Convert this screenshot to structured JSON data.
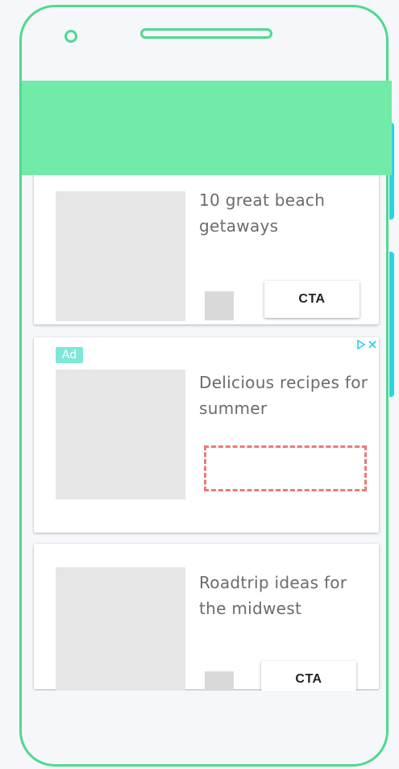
{
  "feed": {
    "cards": [
      {
        "title": "10 great beach getaways",
        "cta": "CTA"
      },
      {
        "ad_badge": "Ad",
        "title": "Delicious recipes for summer"
      },
      {
        "title": "Roadtrip ideas for the midwest",
        "cta": "CTA"
      }
    ]
  },
  "colors": {
    "frame": "#4fd98f",
    "header": "#72eaa8",
    "ad_badge": "#7ee7d8",
    "adchoices": "#2bd3e6",
    "placeholder_border": "#f07878"
  },
  "icons": {
    "adchoices": [
      "adchoices-play-icon",
      "adchoices-close-icon"
    ]
  }
}
